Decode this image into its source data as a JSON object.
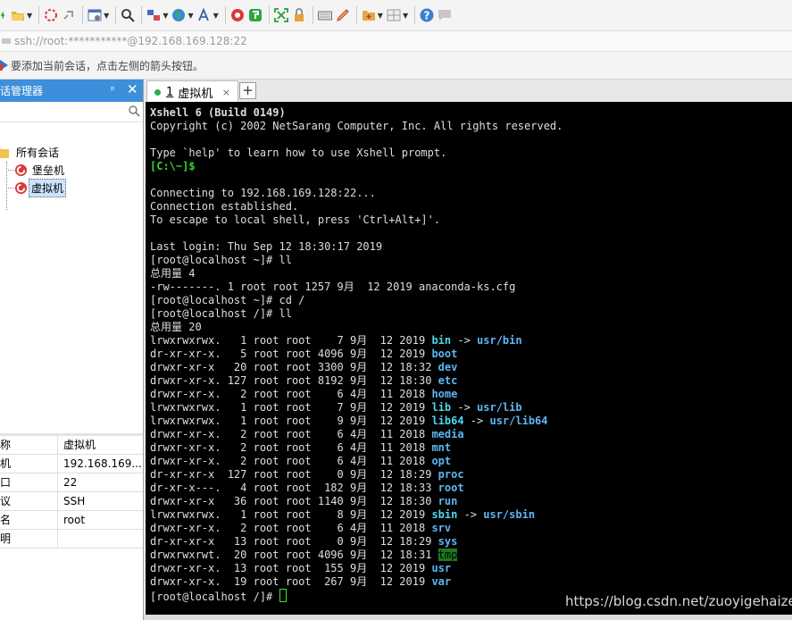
{
  "address": {
    "text": "ssh://root:***********@192.168.169.128:22"
  },
  "hint": {
    "text": "要添加当前会话，点击左侧的箭头按钮。"
  },
  "session_manager": {
    "title": "会话管理器",
    "pin": "ᵖ",
    "close": "✕",
    "tree": {
      "root": "所有会话",
      "items": [
        "堡垒机",
        "虚拟机"
      ]
    },
    "properties": [
      {
        "key": "名称",
        "value": "虚拟机"
      },
      {
        "key": "主机",
        "value": "192.168.169...."
      },
      {
        "key": "端口",
        "value": "22"
      },
      {
        "key": "协议",
        "value": "SSH"
      },
      {
        "key": "用户名",
        "value": "root"
      },
      {
        "key": "说明",
        "value": ""
      }
    ]
  },
  "tab": {
    "number": "1",
    "label": "虚拟机",
    "close": "×",
    "add": "+"
  },
  "terminal": {
    "header1": "Xshell 6 (Build 0149)",
    "header2": "Copyright (c) 2002 NetSarang Computer, Inc. All rights reserved.",
    "help": "Type `help' to learn how to use Xshell prompt.",
    "local_prompt": "[C:\\~]$",
    "connecting": "Connecting to 192.168.169.128:22...",
    "established": "Connection established.",
    "escape": "To escape to local shell, press 'Ctrl+Alt+]'.",
    "last_login": "Last login: Thu Sep 12 18:30:17 2019",
    "cmd1": "[root@localhost ~]# ll",
    "total1": "总用量 4",
    "file1": "-rw-------. 1 root root 1257 9月  12 2019 anaconda-ks.cfg",
    "cmd2": "[root@localhost ~]# cd /",
    "cmd3": "[root@localhost /]# ll",
    "total2": "总用量 20",
    "listing": [
      {
        "meta": "lrwxrwxrwx.   1 root root    7 9月  12 2019 ",
        "name": "bin",
        "arrow": " -> ",
        "target": "usr/bin"
      },
      {
        "meta": "dr-xr-xr-x.   5 root root 4096 9月  12 2019 ",
        "name": "boot"
      },
      {
        "meta": "drwxr-xr-x   20 root root 3300 9月  12 18:32 ",
        "name": "dev"
      },
      {
        "meta": "drwxr-xr-x. 127 root root 8192 9月  12 18:30 ",
        "name": "etc"
      },
      {
        "meta": "drwxr-xr-x.   2 root root    6 4月  11 2018 ",
        "name": "home"
      },
      {
        "meta": "lrwxrwxrwx.   1 root root    7 9月  12 2019 ",
        "name": "lib",
        "arrow": " -> ",
        "target": "usr/lib"
      },
      {
        "meta": "lrwxrwxrwx.   1 root root    9 9月  12 2019 ",
        "name": "lib64",
        "arrow": " -> ",
        "target": "usr/lib64"
      },
      {
        "meta": "drwxr-xr-x.   2 root root    6 4月  11 2018 ",
        "name": "media"
      },
      {
        "meta": "drwxr-xr-x.   2 root root    6 4月  11 2018 ",
        "name": "mnt"
      },
      {
        "meta": "drwxr-xr-x.   2 root root    6 4月  11 2018 ",
        "name": "opt"
      },
      {
        "meta": "dr-xr-xr-x  127 root root    0 9月  12 18:29 ",
        "name": "proc"
      },
      {
        "meta": "dr-xr-x---.   4 root root  182 9月  12 18:33 ",
        "name": "root"
      },
      {
        "meta": "drwxr-xr-x   36 root root 1140 9月  12 18:30 ",
        "name": "run"
      },
      {
        "meta": "lrwxrwxrwx.   1 root root    8 9月  12 2019 ",
        "name": "sbin",
        "arrow": " -> ",
        "target": "usr/sbin"
      },
      {
        "meta": "drwxr-xr-x.   2 root root    6 4月  11 2018 ",
        "name": "srv"
      },
      {
        "meta": "dr-xr-xr-x   13 root root    0 9月  12 18:29 ",
        "name": "sys"
      },
      {
        "meta": "drwxrwxrwt.  20 root root 4096 9月  12 18:31 ",
        "name": "tmp"
      },
      {
        "meta": "drwxr-xr-x.  13 root root  155 9月  12 2019 ",
        "name": "usr"
      },
      {
        "meta": "drwxr-xr-x.  19 root root  267 9月  12 2019 ",
        "name": "var"
      }
    ],
    "final_prompt": "[root@localhost /]# "
  },
  "watermark": "https://blog.csdn.net/zuoyigehaizei",
  "colors": {
    "session_header": "#3d8fdc",
    "terminal_bg": "#000000",
    "dir_cyan": "#4fd6ec",
    "prompt_green": "#32d932",
    "tmp_bg": "#1b7a1b"
  },
  "toolbar_icons": [
    "new-session-icon",
    "open-folder-icon",
    "disconnect-icon",
    "reconnect-icon",
    "properties-icon",
    "search-icon",
    "transfer-icon",
    "globe-icon",
    "font-icon",
    "xshell-icon",
    "xftp-icon",
    "fullscreen-icon",
    "lock-icon",
    "keyboard-icon",
    "highlight-icon",
    "add-layout-icon",
    "tile-icon",
    "help-icon",
    "chat-icon"
  ]
}
